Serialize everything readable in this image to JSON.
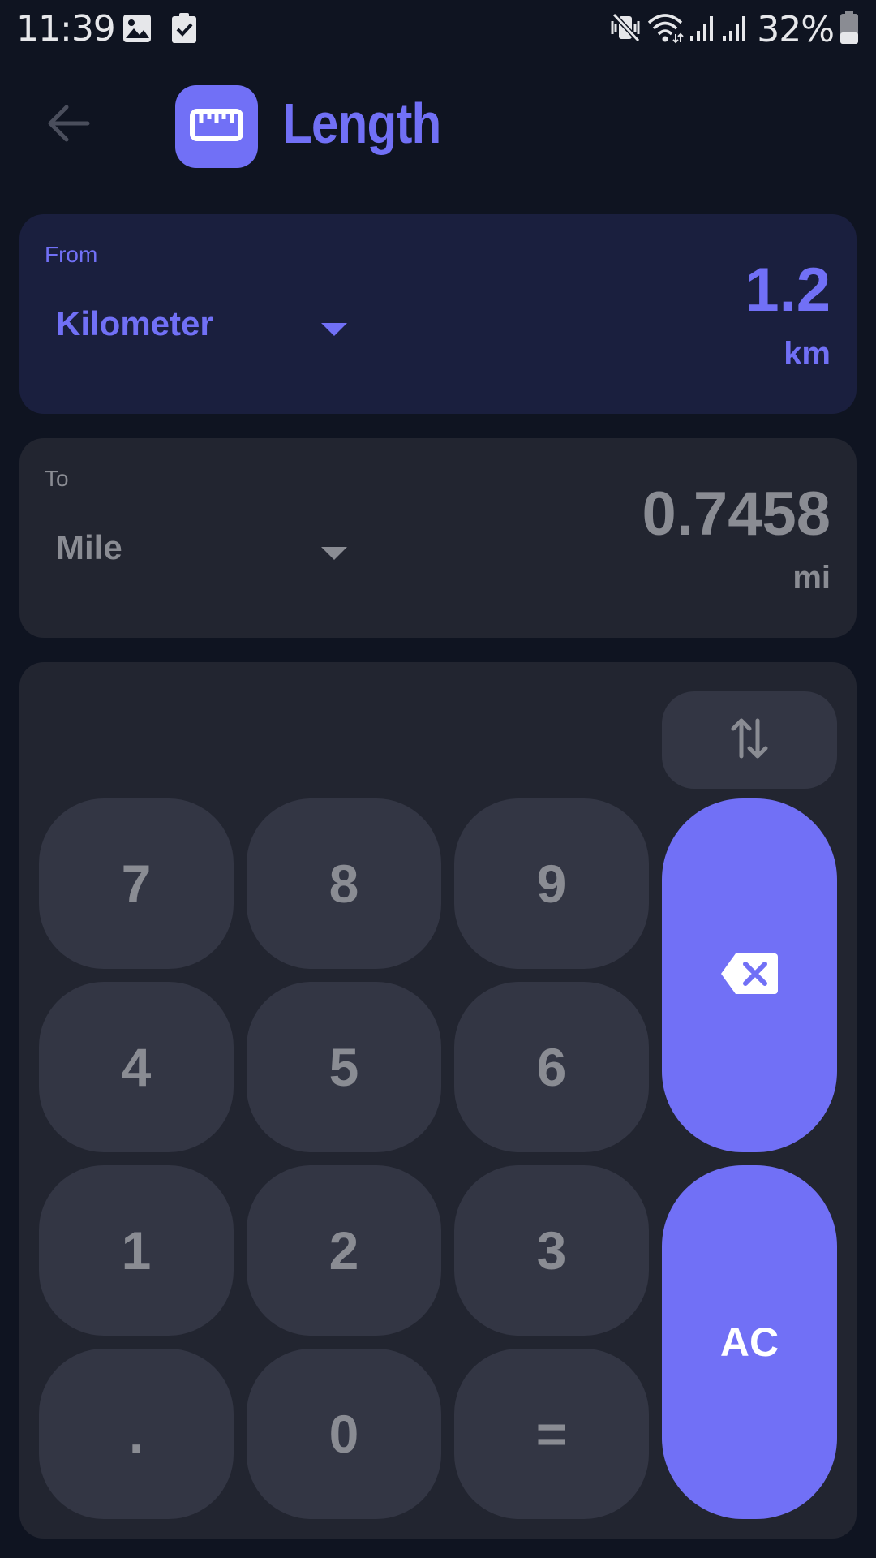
{
  "status_bar": {
    "time": "11:39",
    "battery": "32%"
  },
  "header": {
    "title": "Length",
    "icon": "ruler-icon"
  },
  "from": {
    "label": "From",
    "unit": "Kilometer",
    "value": "1.2",
    "abbr": "km"
  },
  "to": {
    "label": "To",
    "unit": "Mile",
    "value": "0.7458",
    "abbr": "mi"
  },
  "keypad": {
    "keys": [
      "7",
      "8",
      "9",
      "4",
      "5",
      "6",
      "1",
      "2",
      "3",
      ".",
      "0",
      "="
    ],
    "clear_label": "AC",
    "swap_icon": "swap-vertical-icon",
    "backspace_icon": "backspace-icon"
  },
  "colors": {
    "accent": "#7170f6",
    "background": "#0f1421",
    "from_card": "#1a1f3e",
    "to_card": "#222530",
    "key": "#333644",
    "muted_text": "#8a8c93"
  }
}
